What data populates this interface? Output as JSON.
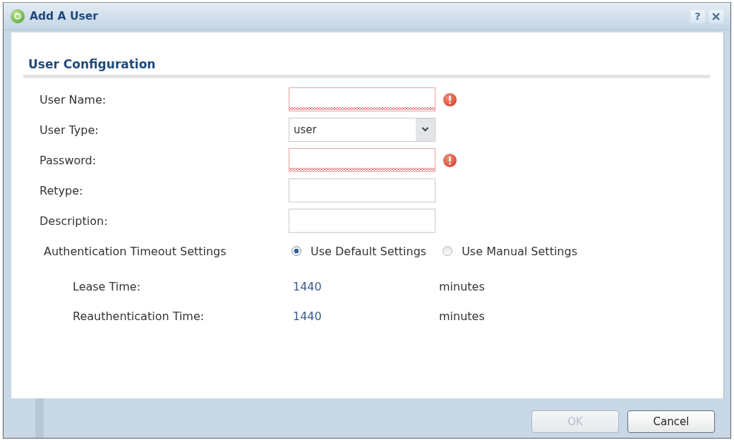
{
  "window": {
    "title": "Add A User",
    "controls": [
      {
        "kind": "help",
        "label": "?"
      },
      {
        "kind": "close"
      }
    ]
  },
  "section": {
    "title": "User Configuration"
  },
  "fields": [
    {
      "kind": "text",
      "label": "User Name:",
      "invalid": true
    },
    {
      "kind": "select",
      "label": "User Type:",
      "value": "user",
      "invalid": false
    },
    {
      "kind": "password",
      "label": "Password:",
      "invalid": true
    },
    {
      "kind": "password",
      "label": "Retype:",
      "invalid": false
    },
    {
      "kind": "text",
      "label": "Description:",
      "invalid": false
    }
  ],
  "auth_timeout": {
    "label": "Authentication Timeout Settings",
    "options": [
      {
        "label": "Use Default Settings",
        "selected": true
      },
      {
        "label": "Use Manual Settings",
        "selected": false
      }
    ],
    "rows": [
      {
        "label": "Lease Time:",
        "value": "1440",
        "unit": "minutes"
      },
      {
        "label": "Reauthentication Time:",
        "value": "1440",
        "unit": "minutes"
      }
    ]
  },
  "buttons": [
    {
      "label": "OK",
      "disabled": true
    },
    {
      "label": "Cancel",
      "disabled": false
    }
  ]
}
